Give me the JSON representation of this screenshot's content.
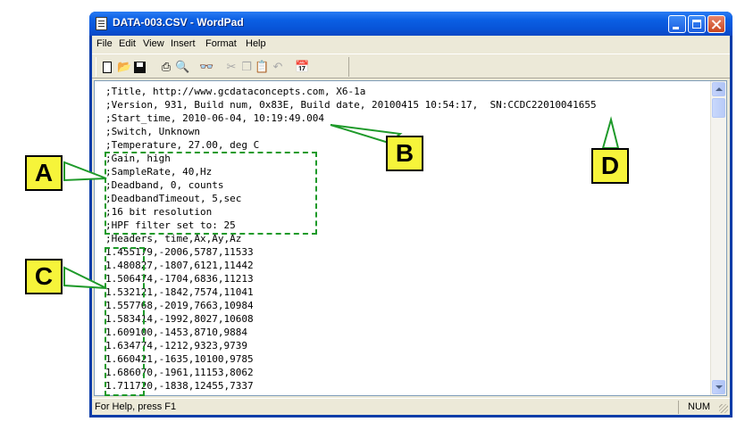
{
  "window": {
    "title": "DATA-003.CSV - WordPad"
  },
  "menu": {
    "items": [
      "File",
      "Edit",
      "View",
      "Insert",
      "Format",
      "Help"
    ]
  },
  "toolbar": {
    "icons": [
      "new-icon",
      "open-icon",
      "save-icon",
      "print-icon",
      "print-preview-icon",
      "find-icon",
      "cut-icon",
      "copy-icon",
      "paste-icon",
      "undo-icon",
      "date-time-icon"
    ]
  },
  "document": {
    "lines": [
      ";Title, http://www.gcdataconcepts.com, X6-1a",
      ";Version, 931, Build num, 0x83E, Build date, 20100415 10:54:17,  SN:CCDC22010041655",
      ";Start_time, 2010-06-04, 10:19:49.004",
      ";Switch, Unknown",
      ";Temperature, 27.00, deg C",
      ";Gain, high",
      ";SampleRate, 40,Hz",
      ";Deadband, 0, counts",
      ";DeadbandTimeout, 5,sec",
      ";16 bit resolution",
      ";HPF filter set to: 25",
      ";Headers, time,Ax,Ay,Az",
      "1.455179,-2006,5787,11533",
      "1.480827,-1807,6121,11442",
      "1.506474,-1704,6836,11213",
      "1.532121,-1842,7574,11041",
      "1.557768,-2019,7663,10984",
      "1.583414,-1992,8027,10608",
      "1.609100,-1453,8710,9884",
      "1.634774,-1212,9323,9739",
      "1.660421,-1635,10100,9785",
      "1.686070,-1961,11153,8062",
      "1.711720,-1838,12455,7337"
    ]
  },
  "statusbar": {
    "help_text": "For Help, press F1",
    "num_indicator": "NUM"
  },
  "annotations": {
    "labels": [
      "A",
      "B",
      "C",
      "D"
    ],
    "color": "#1e9a2a",
    "callout_fill": "#f6f43a"
  }
}
